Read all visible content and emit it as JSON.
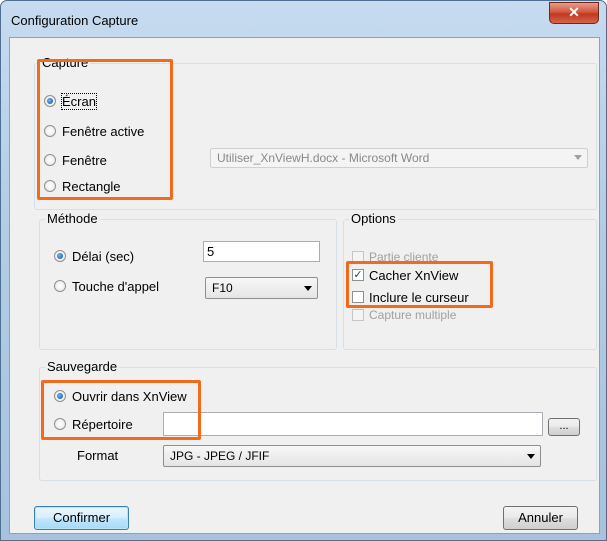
{
  "window": {
    "title": "Configuration Capture",
    "close_symbol": "✕"
  },
  "capture": {
    "legend": "Capture",
    "options": [
      "Écran",
      "Fenêtre active",
      "Fenêtre",
      "Rectangle"
    ],
    "selected": "Écran",
    "window_select": "Utiliser_XnViewH.docx - Microsoft Word"
  },
  "methode": {
    "legend": "Méthode",
    "delay_label": "Délai (sec)",
    "delay_value": "5",
    "hotkey_label": "Touche d'appel",
    "hotkey_value": "F10"
  },
  "options": {
    "legend": "Options",
    "items": [
      {
        "label": "Partie cliente",
        "checked": false,
        "enabled": false
      },
      {
        "label": "Cacher XnView",
        "checked": true,
        "enabled": true
      },
      {
        "label": "Inclure le curseur",
        "checked": false,
        "enabled": true
      },
      {
        "label": "Capture multiple",
        "checked": false,
        "enabled": false
      }
    ]
  },
  "sauvegarde": {
    "legend": "Sauvegarde",
    "open_label": "Ouvrir dans XnView",
    "dir_label": "Répertoire",
    "dir_value": "",
    "browse_label": "...",
    "format_label": "Format",
    "format_value": "JPG - JPEG / JFIF"
  },
  "buttons": {
    "confirm": "Confirmer",
    "cancel": "Annuler"
  },
  "colors": {
    "highlight": "#f26b1d",
    "titlebar": "#b3cde6",
    "close": "#c7412a"
  }
}
